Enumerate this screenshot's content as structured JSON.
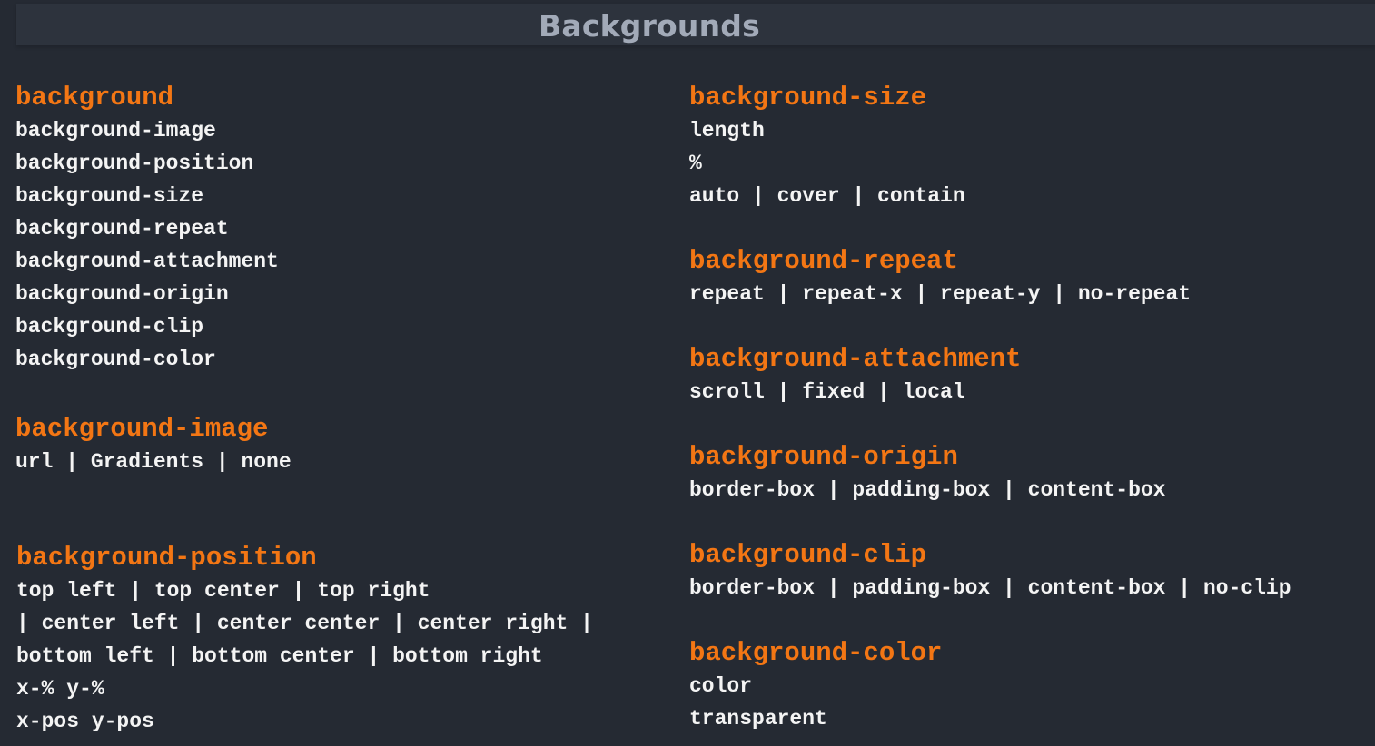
{
  "page_title": "Backgrounds",
  "colors": {
    "background": "#252a33",
    "title_bar": "#2d333d",
    "title_text": "#a2aab8",
    "heading": "#f37614",
    "text": "#f4f4f4"
  },
  "left_column": {
    "background": {
      "heading": "background",
      "lines": [
        "background-image",
        "background-position",
        "background-size",
        "background-repeat",
        "background-attachment",
        "background-origin",
        "background-clip",
        "background-color"
      ]
    },
    "background_image": {
      "heading": "background-image",
      "lines": [
        "url | Gradients | none"
      ]
    },
    "background_position": {
      "heading": "background-position",
      "lines": [
        "top left | top center | top right",
        "| center left | center center | center right |",
        "bottom left | bottom center | bottom right",
        "x-% y-%",
        "x-pos y-pos"
      ]
    }
  },
  "right_column": {
    "background_size": {
      "heading": "background-size",
      "lines": [
        "length",
        "%",
        "auto | cover | contain"
      ]
    },
    "background_repeat": {
      "heading": "background-repeat",
      "lines": [
        "repeat | repeat-x | repeat-y | no-repeat"
      ]
    },
    "background_attachment": {
      "heading": "background-attachment",
      "lines": [
        "scroll | fixed | local"
      ]
    },
    "background_origin": {
      "heading": "background-origin",
      "lines": [
        "border-box | padding-box | content-box"
      ]
    },
    "background_clip": {
      "heading": "background-clip",
      "lines": [
        "border-box | padding-box | content-box | no-clip"
      ]
    },
    "background_color": {
      "heading": "background-color",
      "lines": [
        "color",
        "transparent"
      ]
    }
  }
}
